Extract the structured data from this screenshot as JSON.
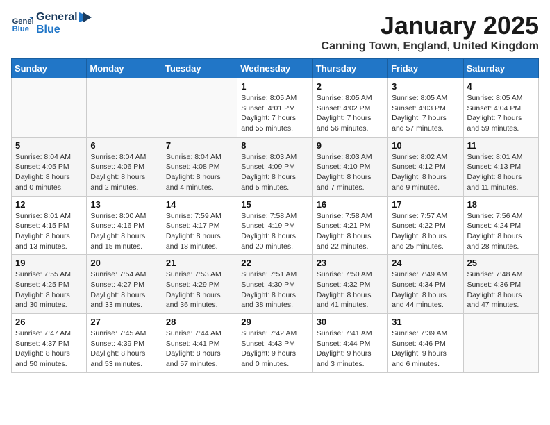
{
  "logo": {
    "line1": "General",
    "line2": "Blue"
  },
  "title": "January 2025",
  "location": "Canning Town, England, United Kingdom",
  "headers": [
    "Sunday",
    "Monday",
    "Tuesday",
    "Wednesday",
    "Thursday",
    "Friday",
    "Saturday"
  ],
  "weeks": [
    [
      {
        "day": "",
        "detail": ""
      },
      {
        "day": "",
        "detail": ""
      },
      {
        "day": "",
        "detail": ""
      },
      {
        "day": "1",
        "detail": "Sunrise: 8:05 AM\nSunset: 4:01 PM\nDaylight: 7 hours and 55 minutes."
      },
      {
        "day": "2",
        "detail": "Sunrise: 8:05 AM\nSunset: 4:02 PM\nDaylight: 7 hours and 56 minutes."
      },
      {
        "day": "3",
        "detail": "Sunrise: 8:05 AM\nSunset: 4:03 PM\nDaylight: 7 hours and 57 minutes."
      },
      {
        "day": "4",
        "detail": "Sunrise: 8:05 AM\nSunset: 4:04 PM\nDaylight: 7 hours and 59 minutes."
      }
    ],
    [
      {
        "day": "5",
        "detail": "Sunrise: 8:04 AM\nSunset: 4:05 PM\nDaylight: 8 hours and 0 minutes."
      },
      {
        "day": "6",
        "detail": "Sunrise: 8:04 AM\nSunset: 4:06 PM\nDaylight: 8 hours and 2 minutes."
      },
      {
        "day": "7",
        "detail": "Sunrise: 8:04 AM\nSunset: 4:08 PM\nDaylight: 8 hours and 4 minutes."
      },
      {
        "day": "8",
        "detail": "Sunrise: 8:03 AM\nSunset: 4:09 PM\nDaylight: 8 hours and 5 minutes."
      },
      {
        "day": "9",
        "detail": "Sunrise: 8:03 AM\nSunset: 4:10 PM\nDaylight: 8 hours and 7 minutes."
      },
      {
        "day": "10",
        "detail": "Sunrise: 8:02 AM\nSunset: 4:12 PM\nDaylight: 8 hours and 9 minutes."
      },
      {
        "day": "11",
        "detail": "Sunrise: 8:01 AM\nSunset: 4:13 PM\nDaylight: 8 hours and 11 minutes."
      }
    ],
    [
      {
        "day": "12",
        "detail": "Sunrise: 8:01 AM\nSunset: 4:15 PM\nDaylight: 8 hours and 13 minutes."
      },
      {
        "day": "13",
        "detail": "Sunrise: 8:00 AM\nSunset: 4:16 PM\nDaylight: 8 hours and 15 minutes."
      },
      {
        "day": "14",
        "detail": "Sunrise: 7:59 AM\nSunset: 4:17 PM\nDaylight: 8 hours and 18 minutes."
      },
      {
        "day": "15",
        "detail": "Sunrise: 7:58 AM\nSunset: 4:19 PM\nDaylight: 8 hours and 20 minutes."
      },
      {
        "day": "16",
        "detail": "Sunrise: 7:58 AM\nSunset: 4:21 PM\nDaylight: 8 hours and 22 minutes."
      },
      {
        "day": "17",
        "detail": "Sunrise: 7:57 AM\nSunset: 4:22 PM\nDaylight: 8 hours and 25 minutes."
      },
      {
        "day": "18",
        "detail": "Sunrise: 7:56 AM\nSunset: 4:24 PM\nDaylight: 8 hours and 28 minutes."
      }
    ],
    [
      {
        "day": "19",
        "detail": "Sunrise: 7:55 AM\nSunset: 4:25 PM\nDaylight: 8 hours and 30 minutes."
      },
      {
        "day": "20",
        "detail": "Sunrise: 7:54 AM\nSunset: 4:27 PM\nDaylight: 8 hours and 33 minutes."
      },
      {
        "day": "21",
        "detail": "Sunrise: 7:53 AM\nSunset: 4:29 PM\nDaylight: 8 hours and 36 minutes."
      },
      {
        "day": "22",
        "detail": "Sunrise: 7:51 AM\nSunset: 4:30 PM\nDaylight: 8 hours and 38 minutes."
      },
      {
        "day": "23",
        "detail": "Sunrise: 7:50 AM\nSunset: 4:32 PM\nDaylight: 8 hours and 41 minutes."
      },
      {
        "day": "24",
        "detail": "Sunrise: 7:49 AM\nSunset: 4:34 PM\nDaylight: 8 hours and 44 minutes."
      },
      {
        "day": "25",
        "detail": "Sunrise: 7:48 AM\nSunset: 4:36 PM\nDaylight: 8 hours and 47 minutes."
      }
    ],
    [
      {
        "day": "26",
        "detail": "Sunrise: 7:47 AM\nSunset: 4:37 PM\nDaylight: 8 hours and 50 minutes."
      },
      {
        "day": "27",
        "detail": "Sunrise: 7:45 AM\nSunset: 4:39 PM\nDaylight: 8 hours and 53 minutes."
      },
      {
        "day": "28",
        "detail": "Sunrise: 7:44 AM\nSunset: 4:41 PM\nDaylight: 8 hours and 57 minutes."
      },
      {
        "day": "29",
        "detail": "Sunrise: 7:42 AM\nSunset: 4:43 PM\nDaylight: 9 hours and 0 minutes."
      },
      {
        "day": "30",
        "detail": "Sunrise: 7:41 AM\nSunset: 4:44 PM\nDaylight: 9 hours and 3 minutes."
      },
      {
        "day": "31",
        "detail": "Sunrise: 7:39 AM\nSunset: 4:46 PM\nDaylight: 9 hours and 6 minutes."
      },
      {
        "day": "",
        "detail": ""
      }
    ]
  ]
}
